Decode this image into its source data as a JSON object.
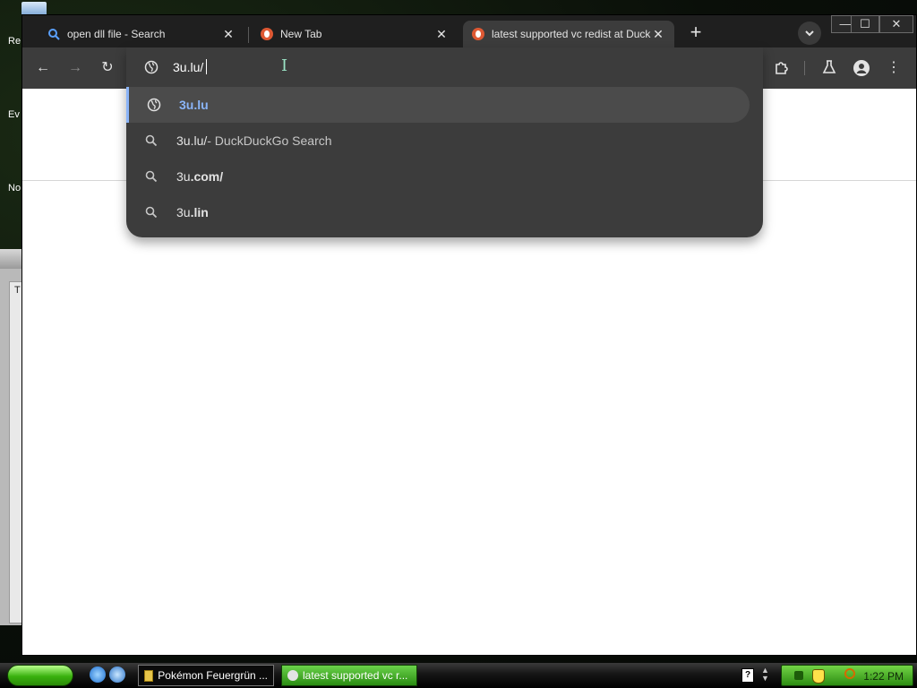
{
  "desktop": {
    "labels": [
      "Re",
      "Ev",
      "No"
    ],
    "bg_window_letter": "T"
  },
  "window_controls": {
    "minimize": "—",
    "maximize": "☐",
    "close": "✕"
  },
  "tabs": [
    {
      "title": "open dll file - Search",
      "favicon": "search-icon",
      "close": "✕"
    },
    {
      "title": "New Tab",
      "favicon": "duckduckgo-icon",
      "close": "✕"
    },
    {
      "title": "latest supported vc redist at DuckD",
      "favicon": "duckduckgo-icon",
      "close": "✕",
      "active": true
    }
  ],
  "toolbar": {
    "back": "←",
    "forward": "→",
    "reload": "↻",
    "new_tab": "+",
    "tab_search": "⌄",
    "extensions": "puzzle-icon",
    "labs": "flask-icon",
    "profile": "profile-icon",
    "menu": "⋮"
  },
  "omnibox": {
    "value": "3u.lu/",
    "suggestions": [
      {
        "icon": "globe-icon",
        "plain": "",
        "bold": "3u.lu",
        "tail": "",
        "selected": true
      },
      {
        "icon": "search-icon",
        "plain": "3u.lu/",
        "bold": "",
        "tail": " - DuckDuckGo Search"
      },
      {
        "icon": "search-icon",
        "plain": "3u",
        "bold": ".com/",
        "tail": ""
      },
      {
        "icon": "search-icon",
        "plain": "3u",
        "bold": ".lin",
        "tail": ""
      }
    ]
  },
  "taskbar": {
    "tasks": [
      {
        "label": "Pokémon Feuergrün ..."
      },
      {
        "label": "latest supported vc r..."
      }
    ],
    "clock": "1:22 PM"
  },
  "colors": {
    "accent": "#8ab4f8",
    "chrome_dark": "#3c3c3c",
    "taskbar_green": "#39b10e"
  }
}
